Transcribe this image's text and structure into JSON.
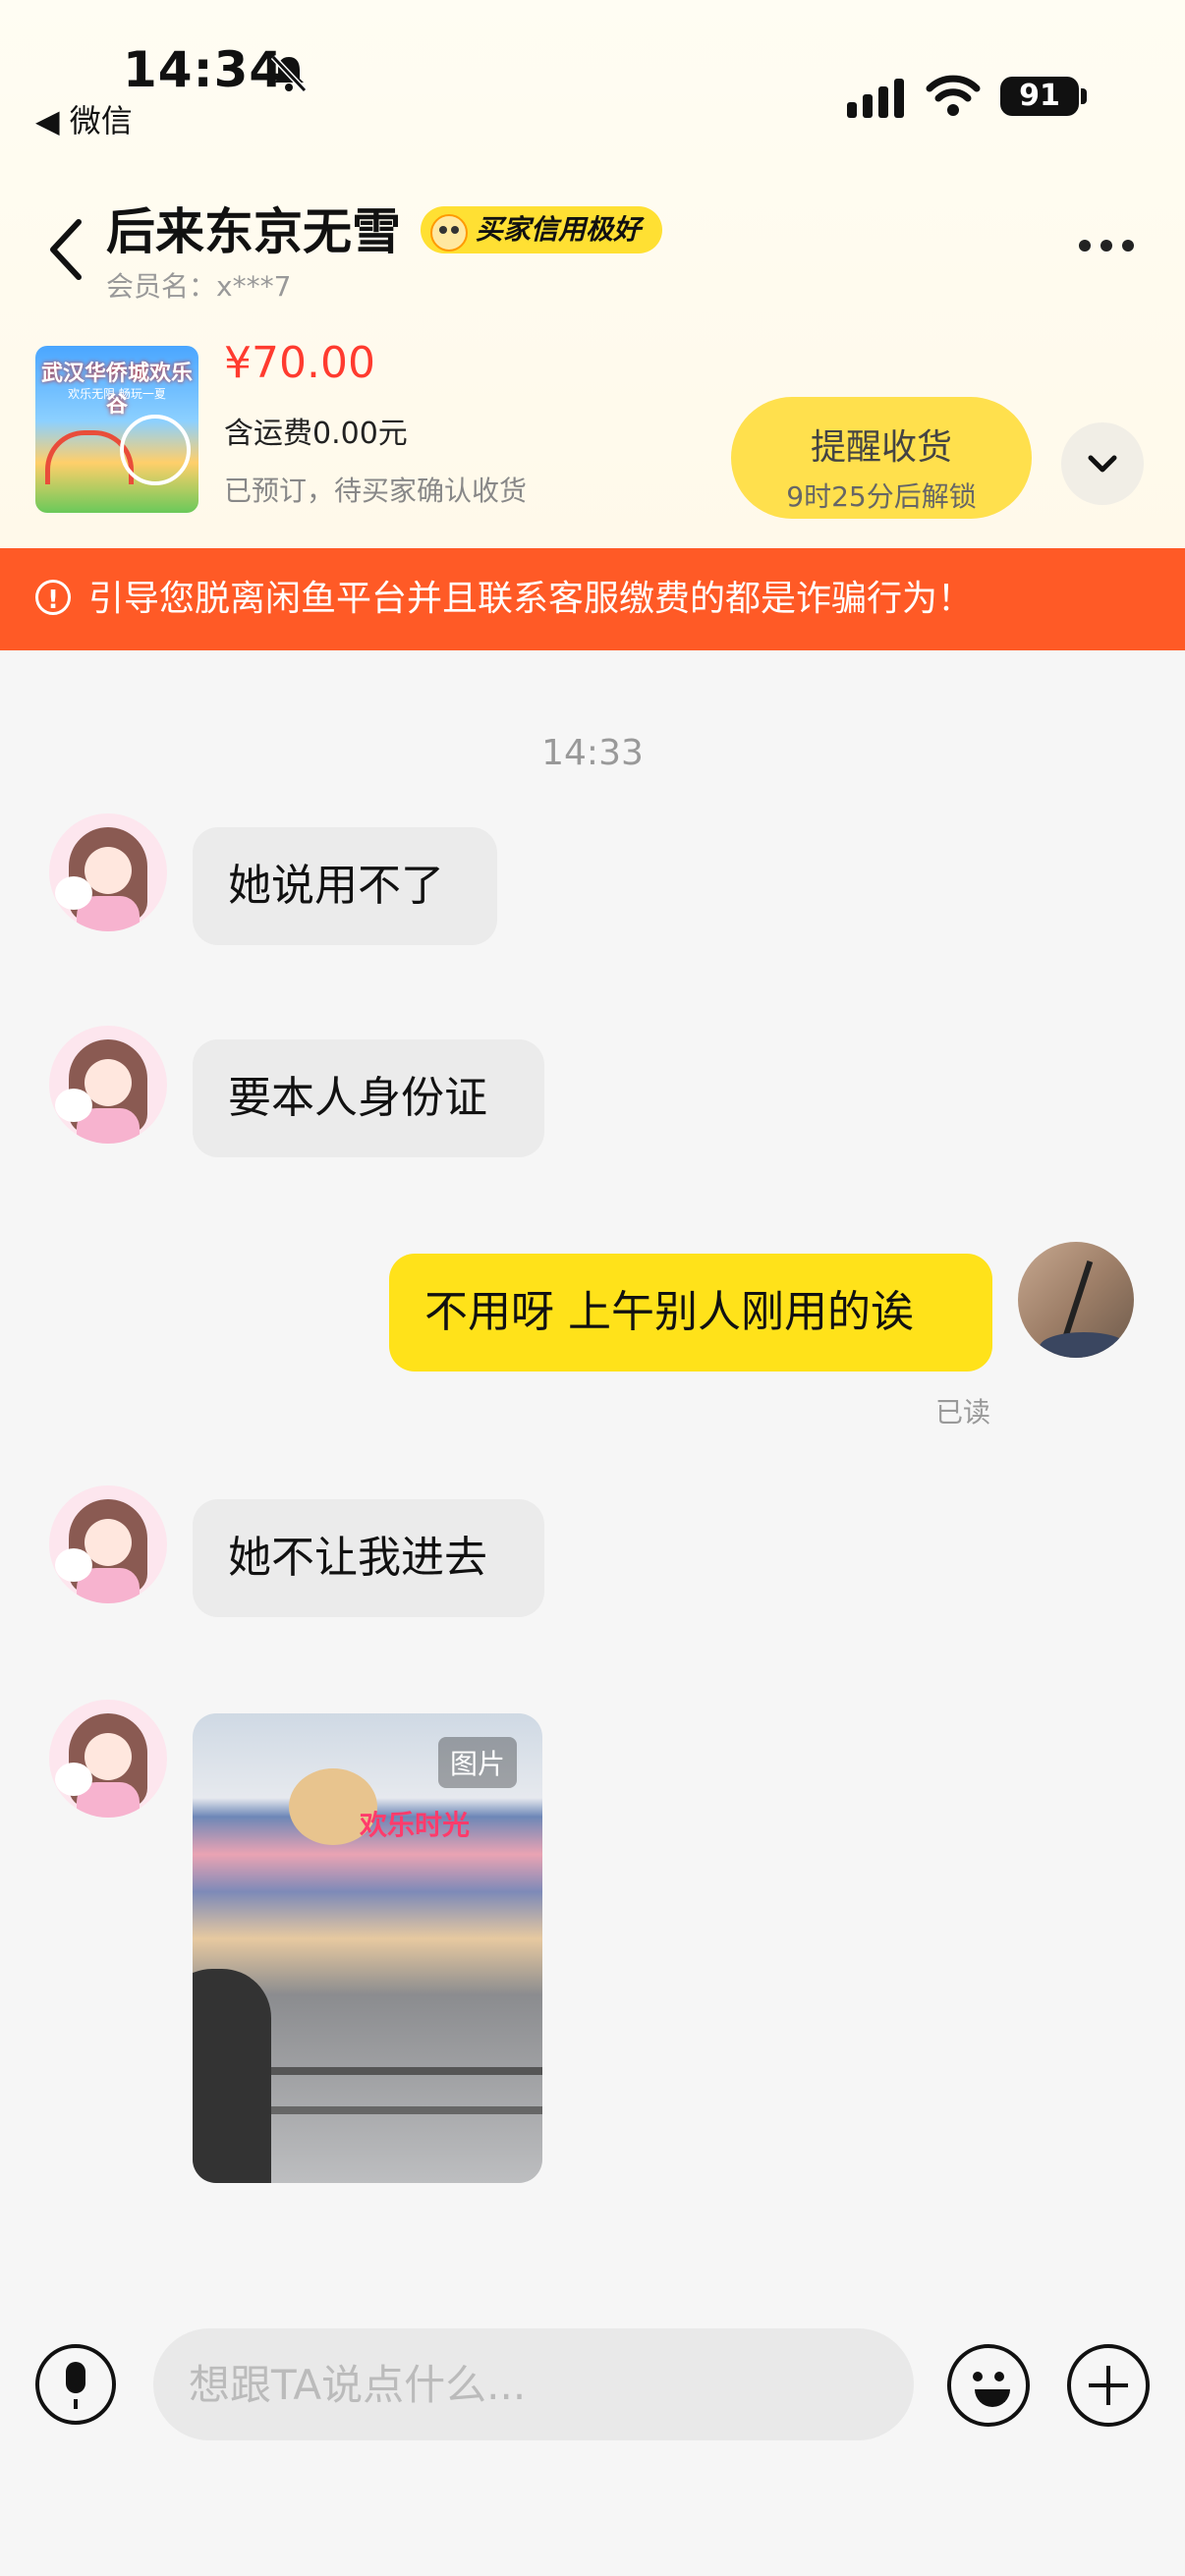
{
  "status_bar": {
    "time": "14:34",
    "back_app": "◀ 微信",
    "battery": "91"
  },
  "header": {
    "title": "后来东京无雪",
    "credit_badge": "买家信用极好",
    "member_label": "会员名：x***7"
  },
  "order": {
    "product_image_title": "武汉华侨城欢乐谷",
    "product_image_sub": "欢乐无限 畅玩一夏",
    "price": "¥70.00",
    "shipping": "含运费0.00元",
    "status": "已预订，待买家确认收货",
    "remind_label": "提醒收货",
    "remind_sub": "9时25分后解锁"
  },
  "warning": {
    "text": "引导您脱离闲鱼平台并且联系客服缴费的都是诈骗行为！"
  },
  "chat": {
    "timestamp": "14:33",
    "messages": [
      {
        "from": "other",
        "text": "她说用不了"
      },
      {
        "from": "other",
        "text": "要本人身份证"
      },
      {
        "from": "me",
        "text": "不用呀 上午别人刚用的诶",
        "read": "已读"
      },
      {
        "from": "other",
        "text": "她不让我进去"
      },
      {
        "from": "other",
        "type": "image",
        "tag": "图片",
        "sign_text": "欢乐时光"
      }
    ]
  },
  "input_bar": {
    "placeholder": "想跟TA说点什么..."
  },
  "colors": {
    "accent_yellow": "#ffe21a",
    "warning_orange": "#ff5a26",
    "price_red": "#ff3b2f"
  }
}
